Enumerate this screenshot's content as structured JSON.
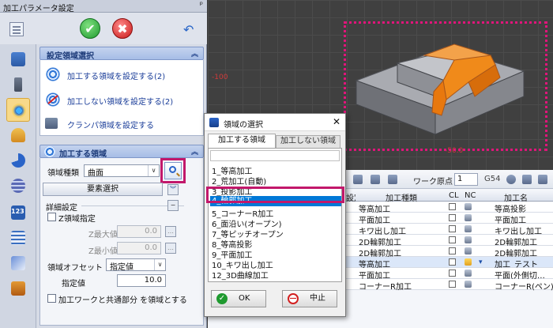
{
  "panel": {
    "title": "加工パラメータ設定",
    "pin": "ᵖ"
  },
  "toolbar": {
    "ok_glyph": "✔",
    "cancel_glyph": "✖",
    "undo_glyph": "↶"
  },
  "region_section": {
    "title": "設定領域選択",
    "chevron": "︽",
    "links": [
      "加工する領域を設定する(2)",
      "加工しない領域を設定する(2)",
      "クランパ領域を設定する"
    ]
  },
  "process_section": {
    "title": "加工する領域",
    "chevron": "︽",
    "type_label": "領域種類",
    "type_value": "曲面",
    "element_select_button": "要素選択",
    "detail_label": "詳細設定",
    "detail_collapse": "−",
    "z_area_label": "Z領域指定",
    "z_max_label": "Z最大値",
    "z_max_value": "0.0",
    "z_min_label": "Z最小値",
    "z_min_value": "0.0",
    "offset_label": "領域オフセット",
    "offset_mode": "指定値",
    "spec_label": "指定値",
    "spec_value": "10.0",
    "common_label": "加工ワークと共通部分 を領域とする"
  },
  "viewport": {
    "label_y": "-100",
    "label_x": "-50.0"
  },
  "table_toolbar": {
    "work_origin_label": "ワーク原点",
    "work_origin_value": "1",
    "g54": "G54"
  },
  "table": {
    "columns": [
      "設定",
      "加工種類",
      "CL",
      "NC",
      "加工名"
    ],
    "rows": [
      {
        "type": "等高加工",
        "name": "等高投影"
      },
      {
        "type": "平面加工",
        "name": "平面加工"
      },
      {
        "type": "キワ出し加工",
        "name": "キワ出し加工"
      },
      {
        "type": "2D輪郭加工",
        "name": "2D輪郭加工"
      },
      {
        "type": "2D輪郭加工",
        "name": "2D輪郭加工"
      },
      {
        "type": "等高加工",
        "name": "加工_テスト"
      },
      {
        "type": "平面加工",
        "name": "平面(外側切…"
      },
      {
        "type": "コーナーR加工",
        "name": "コーナーR(ペン)"
      }
    ]
  },
  "dialog": {
    "title": "領域の選択",
    "close": "✕",
    "tab_active": "加工する領域",
    "tab_inactive": "加工しない領域",
    "items": [
      "1_等高加工",
      "2_荒加工(自動)",
      "3_投影加工",
      "4_輪郭加工",
      "5_コーナーR加工",
      "6_面沿い(オープン)",
      "7_等ピッチオープン",
      "8_等高投影",
      "9_平面加工",
      "10_キワ出し加工",
      "12_3D曲線加工"
    ],
    "selected_index": 3,
    "ok_label": "OK",
    "cancel_label": "中止"
  },
  "colors": {
    "highlight": "#c2186b",
    "selection": "#0078d7",
    "model_orange": "#f08a1a",
    "model_gray": "#8b8d93"
  }
}
